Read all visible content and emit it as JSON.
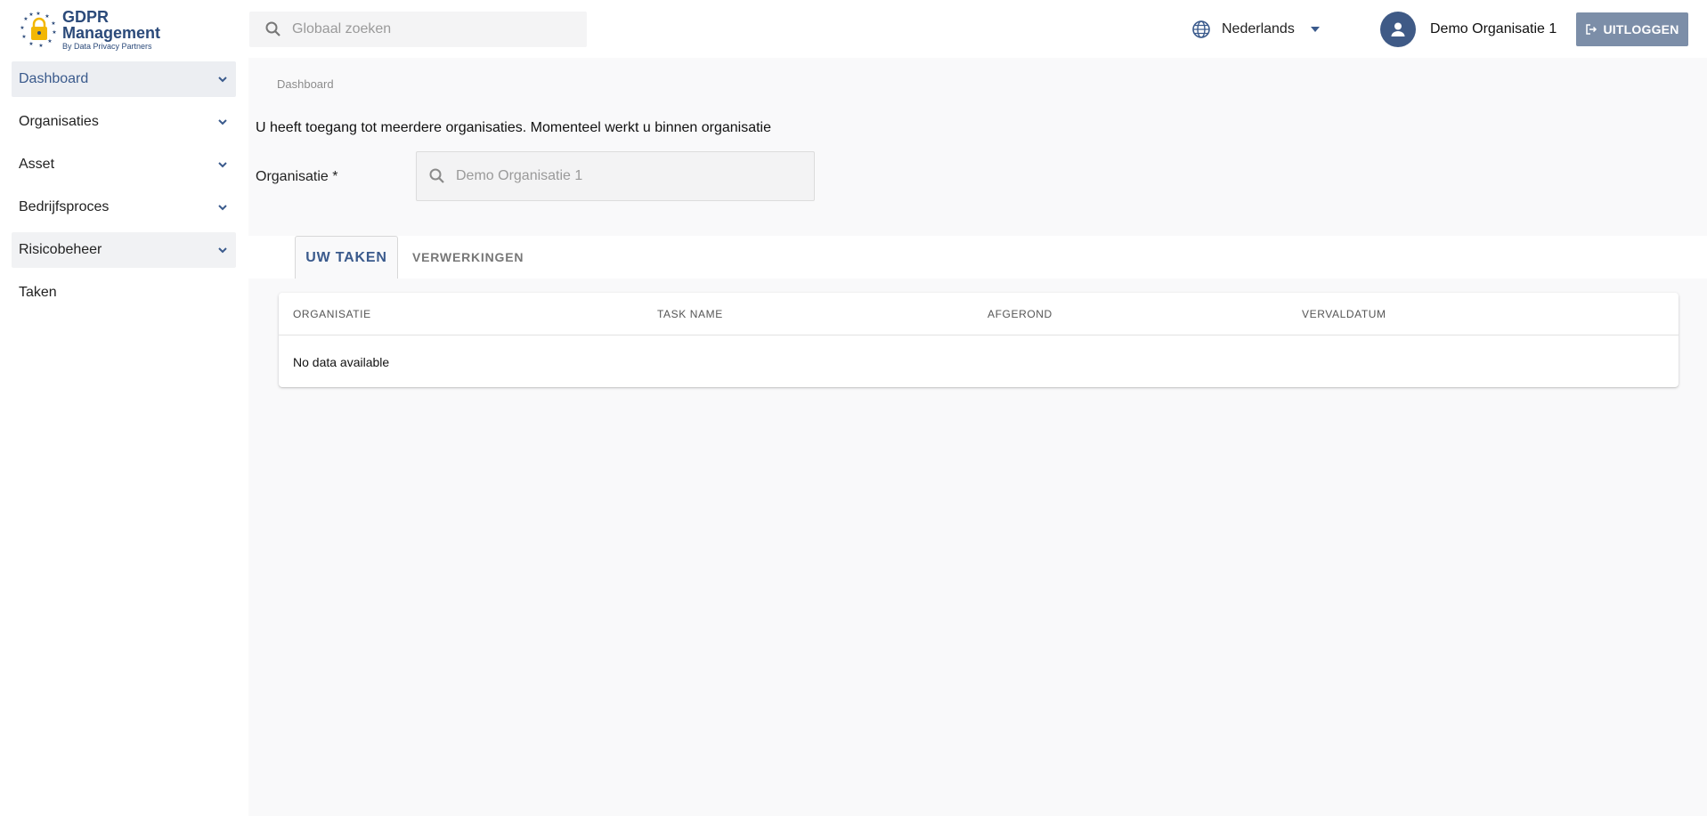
{
  "logo": {
    "title": "GDPR Management",
    "subtitle": "By Data Privacy Partners"
  },
  "sidebar": {
    "items": [
      {
        "label": "Dashboard",
        "has_chevron": true
      },
      {
        "label": "Organisaties",
        "has_chevron": true
      },
      {
        "label": "Asset",
        "has_chevron": true
      },
      {
        "label": "Bedrijfsproces",
        "has_chevron": true
      },
      {
        "label": "Risicobeheer",
        "has_chevron": true
      },
      {
        "label": "Taken",
        "has_chevron": false
      }
    ]
  },
  "header": {
    "search_placeholder": "Globaal zoeken",
    "language": "Nederlands",
    "user_name": "Demo Organisatie 1",
    "logout_label": "UITLOGGEN"
  },
  "main": {
    "breadcrumb": "Dashboard",
    "notice": "U heeft toegang tot meerdere organisaties. Momenteel werkt u binnen organisatie",
    "org_label": "Organisatie *",
    "org_placeholder": "Demo Organisatie 1",
    "tabs": [
      {
        "label": "UW TAKEN",
        "active": true
      },
      {
        "label": "VERWERKINGEN",
        "active": false
      }
    ],
    "table": {
      "columns": [
        "ORGANISATIE",
        "TASK NAME",
        "AFGEROND",
        "VERVALDATUM"
      ],
      "empty_text": "No data available"
    }
  },
  "colors": {
    "accent": "#3a5a8c",
    "avatar": "#3f5a86",
    "logout_bg": "#7c8ea8",
    "main_bg": "#f9f9fa"
  }
}
